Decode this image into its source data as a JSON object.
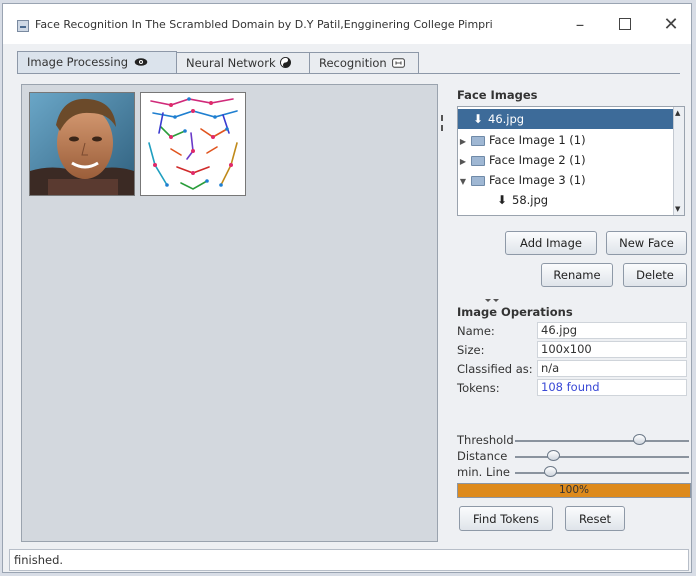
{
  "window": {
    "title": "Face Recognition In The Scrambled Domain by D.Y Patil,Engginering College Pimpri",
    "minimize_glyph": "–",
    "close_glyph": "✕"
  },
  "tabs": [
    {
      "label": "Image Processing",
      "icon": "eye-icon",
      "active": true
    },
    {
      "label": "Neural Network",
      "icon": "yin-yang-icon",
      "active": false
    },
    {
      "label": "Recognition",
      "icon": "face-scan-icon",
      "active": false
    }
  ],
  "face_images": {
    "title": "Face Images",
    "tree": [
      {
        "label": "46.jpg",
        "type": "file",
        "selected": true,
        "indent": 1
      },
      {
        "label": "Face Image 1 (1)",
        "type": "folder",
        "expanded": false
      },
      {
        "label": "Face Image 2 (1)",
        "type": "folder",
        "expanded": false
      },
      {
        "label": "Face Image 3 (1)",
        "type": "folder",
        "expanded": true
      },
      {
        "label": "58.jpg",
        "type": "file",
        "selected": false,
        "indent": 1
      }
    ],
    "buttons": {
      "add_image": "Add Image",
      "new_face": "New Face",
      "rename": "Rename",
      "delete": "Delete"
    }
  },
  "image_operations": {
    "title": "Image Operations",
    "name_label": "Name:",
    "name_value": "46.jpg",
    "size_label": "Size:",
    "size_value": "100x100",
    "classified_label": "Classified as:",
    "classified_value": "n/a",
    "tokens_label": "Tokens:",
    "tokens_value": "108 found",
    "sliders": [
      {
        "label": "Threshold",
        "value": 0.71
      },
      {
        "label": "Distance",
        "value": 0.22
      },
      {
        "label": "min. Line",
        "value": 0.2
      }
    ],
    "progress": {
      "value": 1.0,
      "text": "100%"
    },
    "buttons": {
      "find_tokens": "Find Tokens",
      "reset": "Reset"
    }
  },
  "status": {
    "text": "finished."
  },
  "colors": {
    "selection": "#3d6b99",
    "progress": "#dd8a1c",
    "link": "#3a49d6"
  }
}
